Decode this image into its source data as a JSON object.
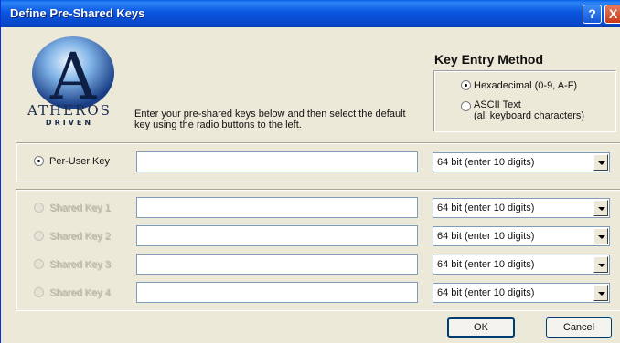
{
  "window": {
    "title": "Define Pre-Shared Keys"
  },
  "titlebar": {
    "help_glyph": "?",
    "close_glyph": "X"
  },
  "brand": {
    "name": "ATHEROS",
    "tagline": "DRIVEN",
    "mark": "A"
  },
  "instructions": "Enter your pre-shared keys below and then select the default key using the radio buttons to the left.",
  "key_entry_method": {
    "title": "Key Entry Method",
    "options": [
      {
        "label": "Hexadecimal (0-9, A-F)",
        "selected": true
      },
      {
        "label_line1": "ASCII Text",
        "label_line2": "(all keyboard characters)",
        "selected": false
      }
    ]
  },
  "per_user_key": {
    "label": "Per-User Key",
    "selected": true,
    "value": "",
    "length_option": "64 bit (enter 10 digits)"
  },
  "shared_keys": [
    {
      "label": "Shared Key 1",
      "enabled": false,
      "value": "",
      "length_option": "64 bit (enter 10 digits)"
    },
    {
      "label": "Shared Key 2",
      "enabled": false,
      "value": "",
      "length_option": "64 bit (enter 10 digits)"
    },
    {
      "label": "Shared Key 3",
      "enabled": false,
      "value": "",
      "length_option": "64 bit (enter 10 digits)"
    },
    {
      "label": "Shared Key 4",
      "enabled": false,
      "value": "",
      "length_option": "64 bit (enter 10 digits)"
    }
  ],
  "buttons": {
    "ok": "OK",
    "cancel": "Cancel"
  },
  "colors": {
    "titlebar": "#0a56e0",
    "dialog_bg": "#ece9d8",
    "logo_blue": "#1b4f9c"
  }
}
